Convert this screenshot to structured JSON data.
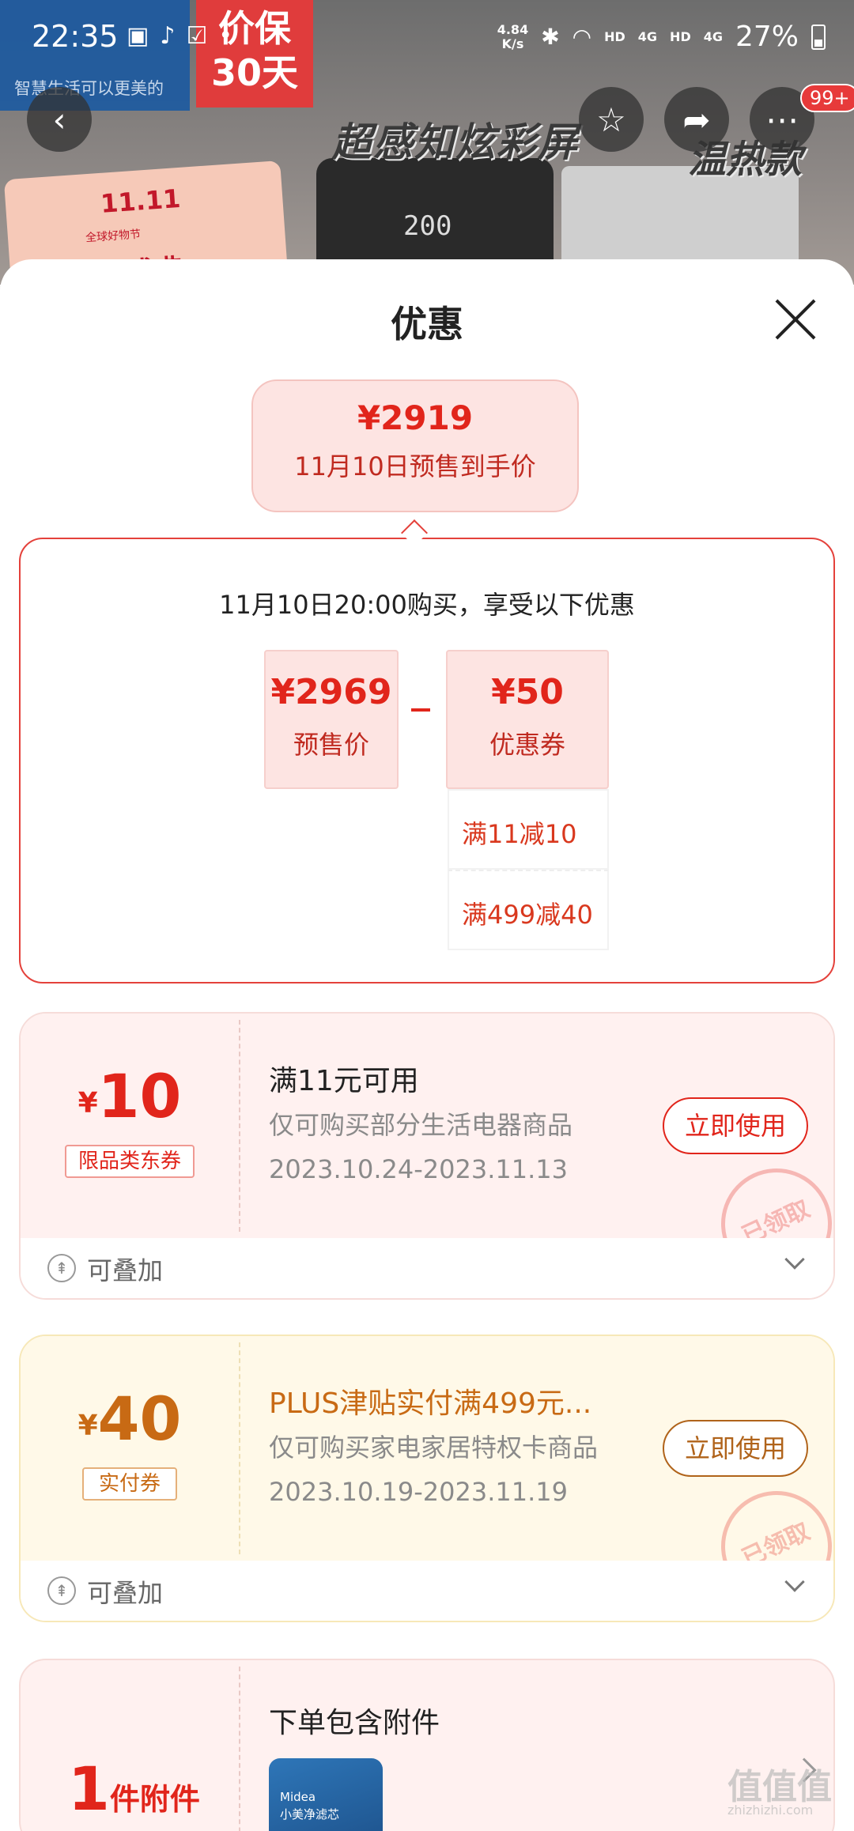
{
  "status_bar": {
    "time": "22:35",
    "net_speed_value": "4.84",
    "net_speed_unit": "K/s",
    "hd1": "HD",
    "net1": "4G",
    "hd2": "HD",
    "net2": "4G",
    "battery": "27%"
  },
  "background": {
    "brand_slogan": "智慧生活可以更美的",
    "promo_line1": "价保",
    "promo_line2": "30天",
    "banner_text": "超感知炫彩屏",
    "banner_text2": "温热款",
    "device_display": "200",
    "sale_title": "11.11",
    "sale_sub": "全球好物节",
    "sale_big": "好物盛典"
  },
  "top_buttons": {
    "badge": "99+"
  },
  "sheet": {
    "title": "优惠",
    "final_price": {
      "value": "¥2919",
      "label": "11月10日预售到手价"
    },
    "calc": {
      "title": "11月10日20:00购买，享受以下优惠",
      "presale_value": "¥2969",
      "presale_label": "预售价",
      "coupon_value": "¥50",
      "coupon_label": "优惠券",
      "sub_items": [
        "满11减10",
        "满499减40"
      ]
    },
    "coupons": [
      {
        "currency": "¥",
        "amount": "10",
        "tag": "限品类东券",
        "title": "满11元可用",
        "desc": "仅可购买部分生活电器商品",
        "date": "2023.10.24-2023.11.13",
        "button": "立即使用",
        "stamp": "已领取",
        "stackable": "可叠加",
        "accent": "#e1251b"
      },
      {
        "currency": "¥",
        "amount": "40",
        "tag": "实付券",
        "title": "PLUS津贴实付满499元...",
        "desc": "仅可购买家电家居特权卡商品",
        "date": "2023.10.19-2023.11.19",
        "button": "立即使用",
        "stamp": "已领取",
        "stackable": "可叠加",
        "accent": "#c86a14"
      }
    ],
    "accessory": {
      "count": "1",
      "unit": "件附件",
      "title": "下单包含附件",
      "thumb_label": "小美净滤芯",
      "thumb_brand": "Midea"
    }
  },
  "watermark": {
    "text": "值值值",
    "sub": "zhizhizhi.com"
  }
}
